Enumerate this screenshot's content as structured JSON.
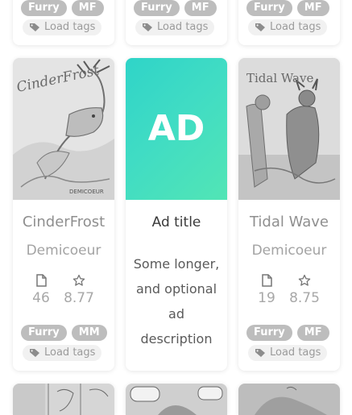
{
  "top_row": [
    {
      "tags": [
        "Furry",
        "MF"
      ],
      "load_tags_label": "Load tags"
    },
    {
      "tags": [
        "Furry",
        "MF"
      ],
      "load_tags_label": "Load tags"
    },
    {
      "tags": [
        "Furry",
        "MF"
      ],
      "load_tags_label": "Load tags"
    }
  ],
  "cards": [
    {
      "title": "CinderFrost",
      "author": "Demicoeur",
      "pages": "46",
      "rating": "8.77",
      "tags": [
        "Furry",
        "MM"
      ],
      "load_tags_label": "Load tags",
      "cover_text": "CinderFrost",
      "cover_signature": "DEMICOEUR"
    },
    {
      "title": "Tidal Wave",
      "author": "Demicoeur",
      "pages": "19",
      "rating": "8.75",
      "tags": [
        "Furry",
        "MF"
      ],
      "load_tags_label": "Load tags",
      "cover_text": "Tidal Wave"
    }
  ],
  "ad": {
    "label": "AD",
    "title": "Ad title",
    "description": [
      "Some longer,",
      "and optional",
      "ad",
      "description"
    ]
  },
  "icons": {
    "pages": "document-icon",
    "rating": "star-icon",
    "tag": "tag-icon"
  },
  "colors": {
    "ad_gradient_start": "#2fd4c8",
    "ad_gradient_end": "#52e5b5",
    "tag_bg": "#bdbdbd"
  }
}
